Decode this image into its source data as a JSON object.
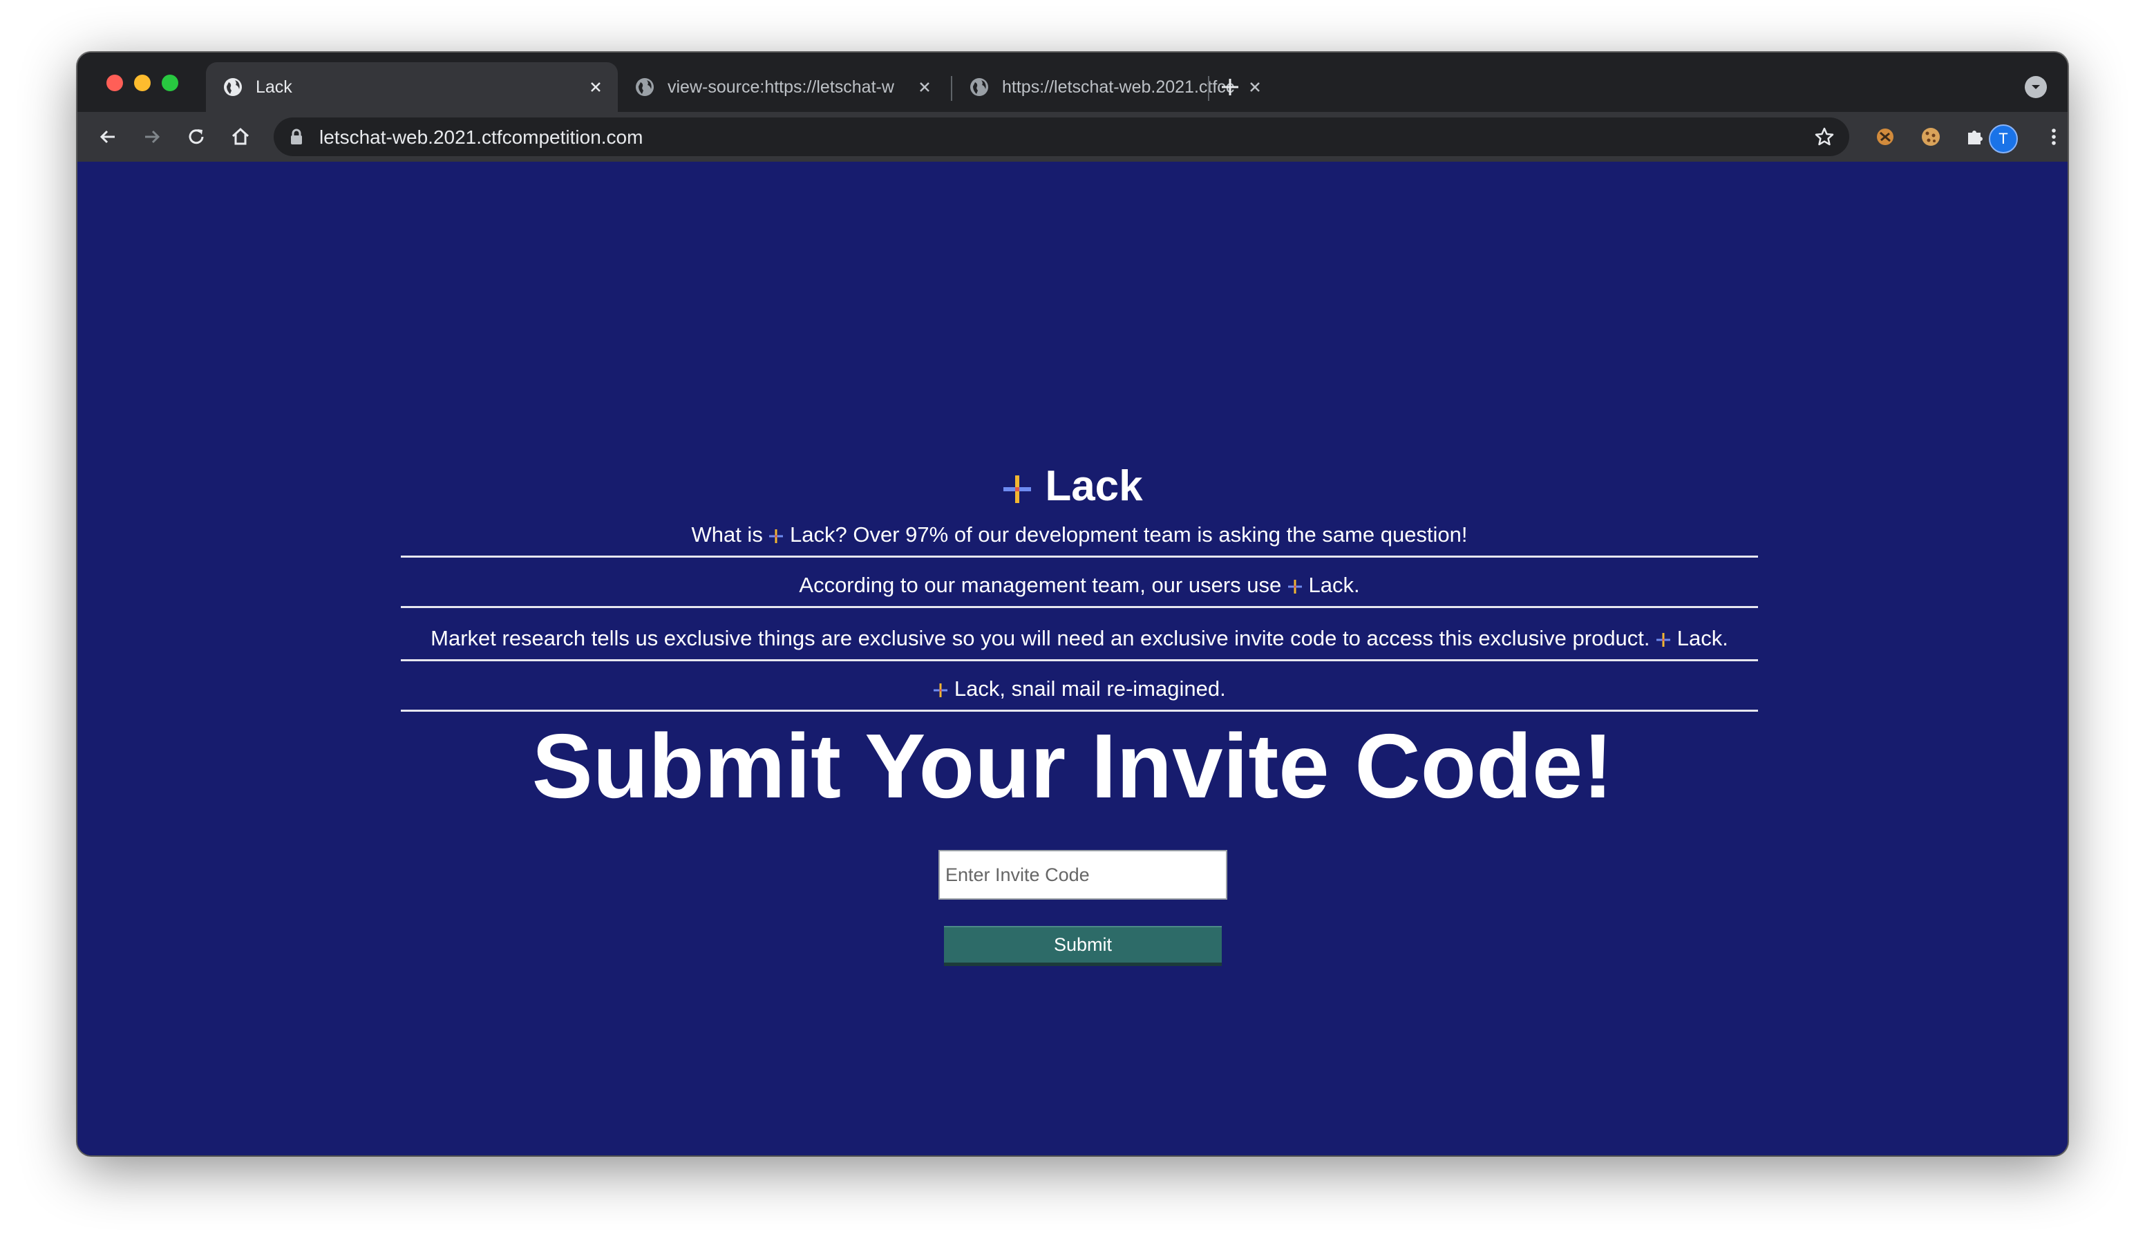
{
  "browser": {
    "tabs": [
      {
        "title": "Lack",
        "active": true
      },
      {
        "title": "view-source:https://letschat-w",
        "active": false
      },
      {
        "title": "https://letschat-web.2021.ctfcc",
        "active": false
      }
    ],
    "url": "letschat-web.2021.ctfcompetition.com",
    "profile_initial": "T",
    "icons": [
      "back-icon",
      "forward-icon",
      "reload-icon",
      "home-icon",
      "lock-icon",
      "star-icon",
      "extension-icon",
      "cookie-icon",
      "puzzle-icon",
      "menu-icon"
    ]
  },
  "page": {
    "brand": "Lack",
    "lines": [
      {
        "before": "What is ",
        "after": " Lack? Over 97% of our development team is asking the same question!"
      },
      {
        "before": "According to our management team, our users use ",
        "after": " Lack."
      },
      {
        "before": "Market research tells us exclusive things are exclusive so you will need an exclusive invite code to access this exclusive product. ",
        "after": " Lack."
      },
      {
        "before": "",
        "after": " Lack, snail mail re-imagined."
      }
    ],
    "heading": "Submit Your Invite Code!",
    "invite_placeholder": "Enter Invite Code",
    "submit_label": "Submit"
  },
  "colors": {
    "page_bg": "#171c6e",
    "button_bg": "#2d6b68",
    "plus_vertical": "#f2b632",
    "plus_horizontal": "#6e8cf0"
  }
}
